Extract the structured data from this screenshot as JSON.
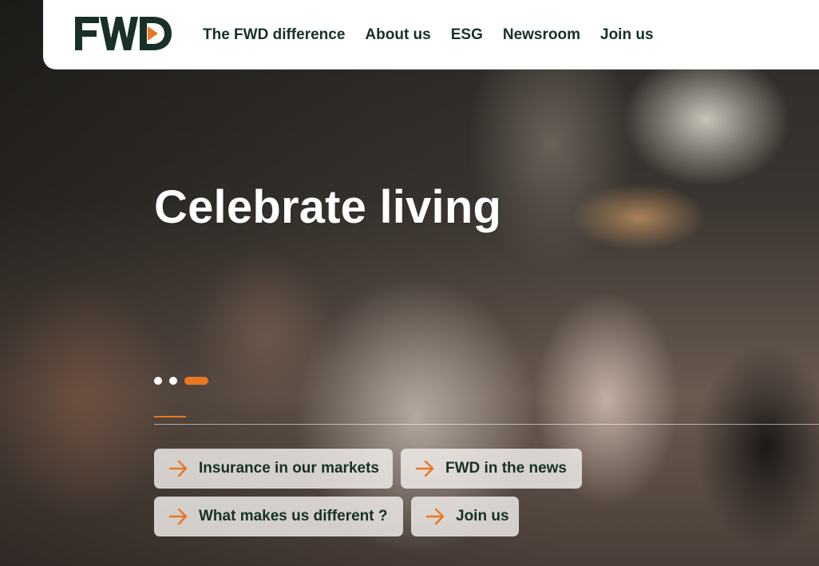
{
  "brand": {
    "logo_text": "FWD",
    "accent_color": "#e87722",
    "text_color": "#183028"
  },
  "nav": {
    "items": [
      {
        "label": "The FWD difference"
      },
      {
        "label": "About us"
      },
      {
        "label": "ESG"
      },
      {
        "label": "Newsroom"
      },
      {
        "label": "Join us"
      }
    ]
  },
  "hero": {
    "headline": "Celebrate living",
    "carousel": {
      "slide_count": 3,
      "active_slide": 3
    }
  },
  "quick_links": [
    {
      "label": "Insurance in our markets",
      "icon": "arrow-right-icon"
    },
    {
      "label": "FWD in the news",
      "icon": "arrow-right-icon"
    },
    {
      "label": "What makes us different ?",
      "icon": "arrow-right-icon"
    },
    {
      "label": "Join us",
      "icon": "arrow-right-icon"
    }
  ]
}
